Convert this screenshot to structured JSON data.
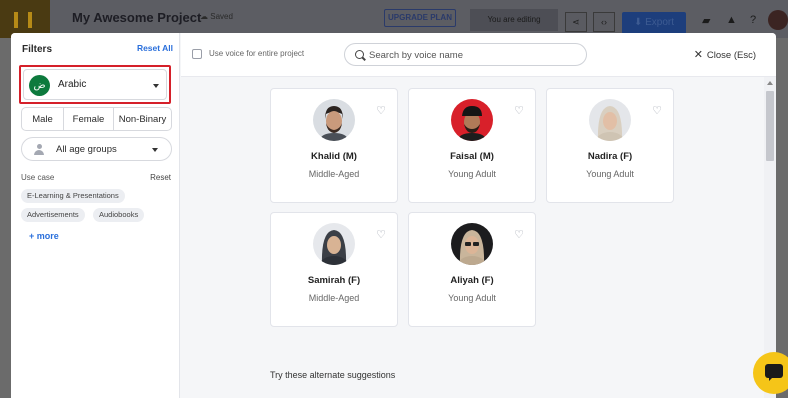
{
  "background": {
    "project_title": "My Awesome Project",
    "saved_label": "Saved",
    "upgrade_label": "UPGRADE PLAN",
    "editing_label": "You are editing",
    "export_label": "Export"
  },
  "filters": {
    "title": "Filters",
    "reset_all": "Reset All",
    "language": {
      "label": "Arabic",
      "flag_text": "ض"
    },
    "genders": [
      "Male",
      "Female",
      "Non-Binary"
    ],
    "age_group": "All age groups",
    "use_case": {
      "label": "Use case",
      "reset": "Reset",
      "chips": [
        "E-Learning & Presentations",
        "Advertisements",
        "Audiobooks"
      ],
      "more": "+ more"
    }
  },
  "header": {
    "checkbox_label": "Use voice for entire project",
    "search_placeholder": "Search by voice name",
    "close_label": "Close (Esc)"
  },
  "voices": [
    {
      "name": "Khalid (M)",
      "age": "Middle-Aged",
      "avatar": "male-beard"
    },
    {
      "name": "Faisal (M)",
      "age": "Young Adult",
      "avatar": "male-cap"
    },
    {
      "name": "Nadira (F)",
      "age": "Young Adult",
      "avatar": "female-hijab-light"
    },
    {
      "name": "Samirah (F)",
      "age": "Middle-Aged",
      "avatar": "female-hijab-dark"
    },
    {
      "name": "Aliyah (F)",
      "age": "Young Adult",
      "avatar": "female-hijab-glasses"
    }
  ],
  "alternate_suggestions": "Try these alternate suggestions",
  "colors": {
    "accent_blue": "#2a6fdb",
    "highlight_red": "#d5202a",
    "flag_green": "#0d7a3d",
    "chat_yellow": "#f5c518"
  }
}
